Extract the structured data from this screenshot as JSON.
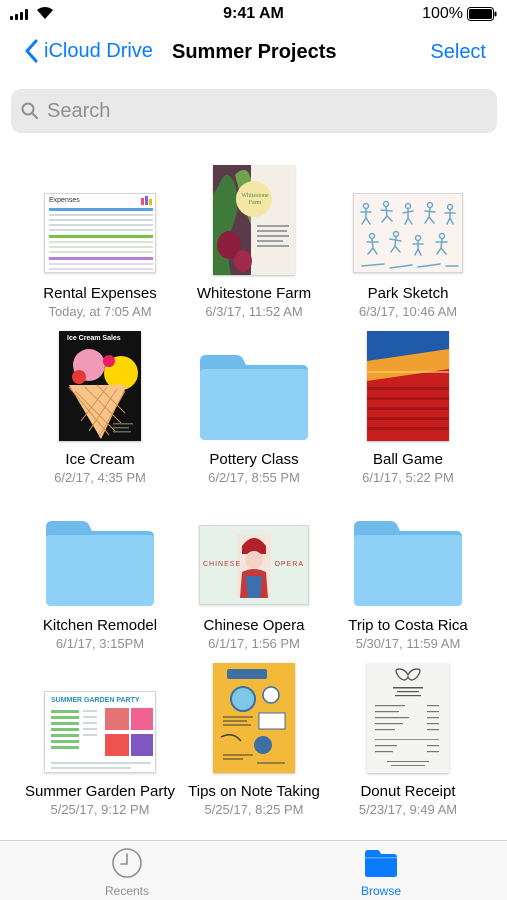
{
  "status_bar": {
    "time": "9:41 AM",
    "battery": "100%"
  },
  "nav": {
    "back_label": "iCloud Drive",
    "title": "Summer Projects",
    "select_label": "Select"
  },
  "search": {
    "placeholder": "Search",
    "value": ""
  },
  "colors": {
    "accent": "#0a7bff",
    "folder": "#7fc6f2",
    "secondary_text": "#8e8e93"
  },
  "files": [
    {
      "name": "Rental Expenses",
      "date": "Today, at 7:05 AM",
      "kind": "spreadsheet",
      "thumb_title": "Expenses"
    },
    {
      "name": "Whitestone Farm",
      "date": "6/3/17, 11:52 AM",
      "kind": "document",
      "thumb_title": "Whitestone Farm"
    },
    {
      "name": "Park Sketch",
      "date": "6/3/17, 10:46 AM",
      "kind": "drawing"
    },
    {
      "name": "Ice Cream",
      "date": "6/2/17, 4:35 PM",
      "kind": "poster",
      "thumb_title": "Ice Cream Sales"
    },
    {
      "name": "Pottery Class",
      "date": "6/2/17, 8:55 PM",
      "kind": "folder"
    },
    {
      "name": "Ball Game",
      "date": "6/1/17, 5:22 PM",
      "kind": "photo"
    },
    {
      "name": "Kitchen Remodel",
      "date": "6/1/17, 3:15PM",
      "kind": "folder"
    },
    {
      "name": "Chinese Opera",
      "date": "6/1/17, 1:56 PM",
      "kind": "presentation",
      "thumb_left": "CHINESE",
      "thumb_right": "OPERA"
    },
    {
      "name": "Trip to Costa Rica",
      "date": "5/30/17, 11:59 AM",
      "kind": "folder"
    },
    {
      "name": "Summer Garden Party",
      "date": "5/25/17, 9:12 PM",
      "kind": "spreadsheet",
      "thumb_title": "SUMMER GARDEN PARTY"
    },
    {
      "name": "Tips on Note Taking",
      "date": "5/25/17, 8:25 PM",
      "kind": "infographic"
    },
    {
      "name": "Donut Receipt",
      "date": "5/23/17, 9:49 AM",
      "kind": "receipt"
    }
  ],
  "tabs": [
    {
      "label": "Recents",
      "icon": "clock-icon",
      "active": false
    },
    {
      "label": "Browse",
      "icon": "folder-icon",
      "active": true
    }
  ]
}
